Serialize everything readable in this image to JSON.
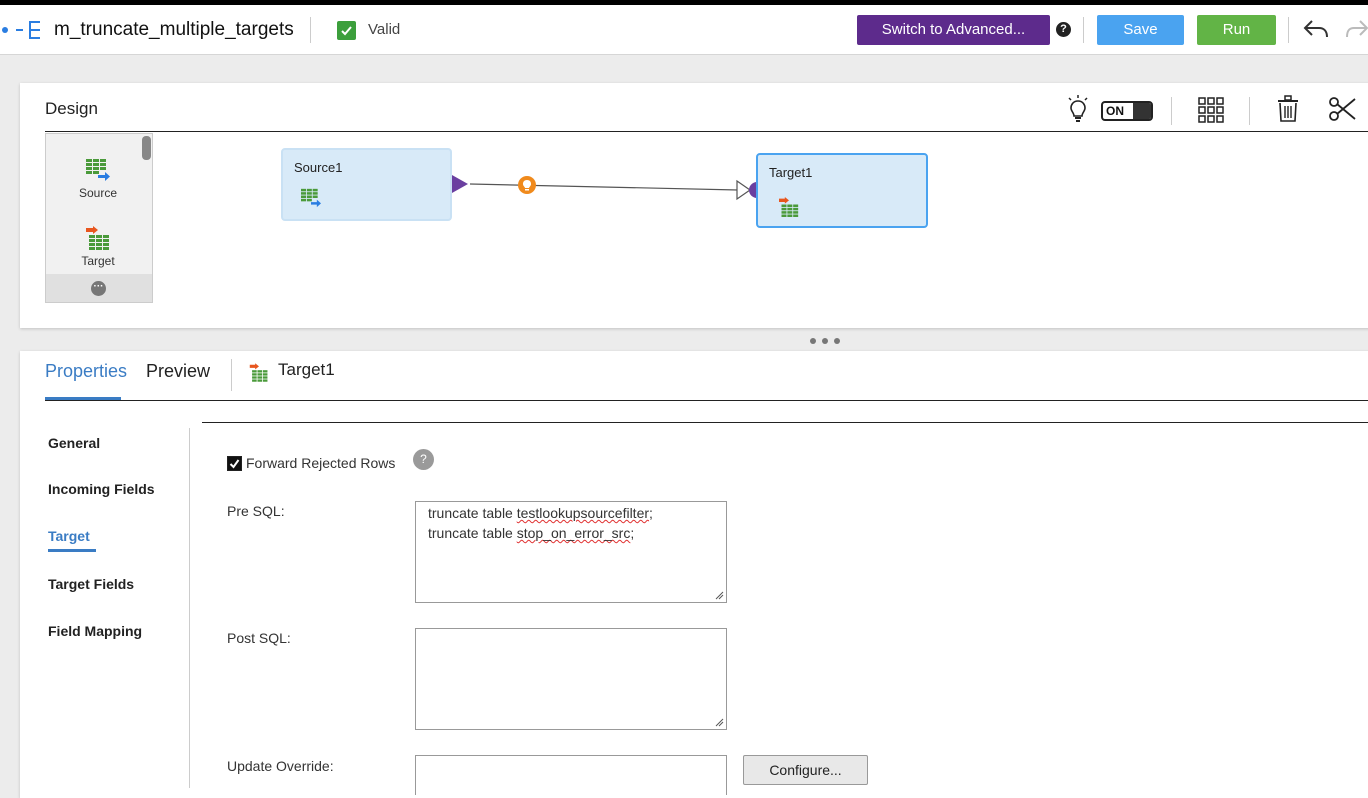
{
  "header": {
    "title": "m_truncate_multiple_targets",
    "valid_label": "Valid",
    "switch_label": "Switch to Advanced...",
    "help_char": "?",
    "save_label": "Save",
    "run_label": "Run"
  },
  "design": {
    "title": "Design",
    "toggle_label": "ON",
    "palette": [
      {
        "label": "Source"
      },
      {
        "label": "Target"
      }
    ],
    "nodes": {
      "source": "Source1",
      "target": "Target1"
    }
  },
  "properties": {
    "tabs": {
      "properties": "Properties",
      "preview": "Preview",
      "object": "Target1"
    },
    "nav": [
      "General",
      "Incoming Fields",
      "Target",
      "Target Fields",
      "Field Mapping"
    ],
    "forward_rejected_label": "Forward Rejected Rows",
    "forward_rejected_checked": true,
    "help_char": "?",
    "pre_sql_label": "Pre SQL:",
    "pre_sql_lines": [
      {
        "prefix": "truncate table ",
        "name": "testlookupsourcefilter",
        "suffix": ";"
      },
      {
        "prefix": "truncate table ",
        "name": "stop_on_error_src",
        "suffix": ";"
      }
    ],
    "post_sql_label": "Post SQL:",
    "update_override_label": "Update Override:",
    "configure_label": "Configure..."
  },
  "colors": {
    "accent_blue": "#3a7cc4",
    "save_blue": "#4aa3f0",
    "run_green": "#62b446",
    "switch_purple": "#5d2b8c",
    "valid_green": "#3c9f3c"
  }
}
